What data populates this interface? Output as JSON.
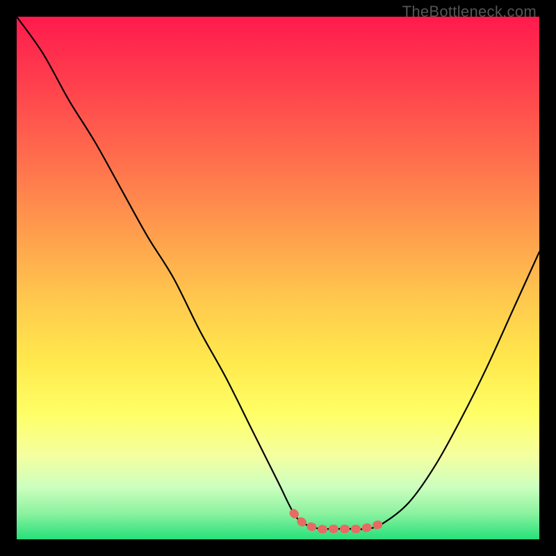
{
  "watermark": "TheBottleneck.com",
  "chart_data": {
    "type": "line",
    "title": "",
    "xlabel": "",
    "ylabel": "",
    "xlim": [
      0,
      100
    ],
    "ylim": [
      0,
      100
    ],
    "series": [
      {
        "name": "curve",
        "x": [
          0,
          5,
          10,
          15,
          20,
          25,
          30,
          35,
          40,
          45,
          50,
          53,
          55,
          58,
          60,
          64,
          67,
          70,
          75,
          80,
          85,
          90,
          95,
          100
        ],
        "y": [
          100,
          93,
          84,
          76,
          67,
          58,
          50,
          40,
          31,
          21,
          11,
          5,
          3,
          2,
          2,
          2,
          2,
          3,
          7,
          14,
          23,
          33,
          44,
          55
        ]
      },
      {
        "name": "highlight",
        "x": [
          53,
          55,
          58,
          60,
          62,
          64,
          66,
          68,
          70
        ],
        "y": [
          5,
          3,
          2,
          2,
          2,
          2,
          2,
          2.5,
          3
        ]
      }
    ],
    "colors": {
      "curve": "#000000",
      "highlight": "#e86a63"
    }
  }
}
